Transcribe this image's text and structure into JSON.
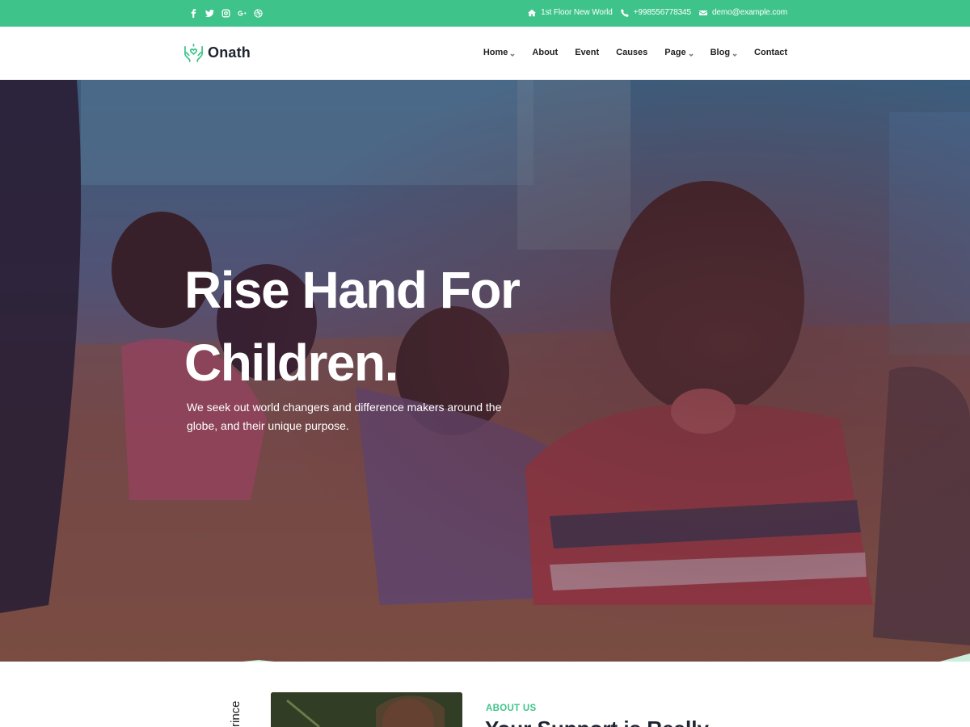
{
  "topbar": {
    "social": [
      "facebook-icon",
      "twitter-icon",
      "instagram-icon",
      "google-plus-icon",
      "dribbble-icon"
    ],
    "address": "1st Floor New World",
    "phone": "+998556778345",
    "email": "demo@example.com"
  },
  "brand": {
    "name": "Onath",
    "accent": "#3ec48a"
  },
  "nav": {
    "items": [
      {
        "label": "Home",
        "dropdown": true
      },
      {
        "label": "About",
        "dropdown": false
      },
      {
        "label": "Event",
        "dropdown": false
      },
      {
        "label": "Causes",
        "dropdown": false
      },
      {
        "label": "Page",
        "dropdown": true
      },
      {
        "label": "Blog",
        "dropdown": true
      },
      {
        "label": "Contact",
        "dropdown": false
      }
    ]
  },
  "hero": {
    "title_line1": "Rise Hand For",
    "title_line2": "Children.",
    "text": "We seek out world changers and difference makers around the globe, and their unique purpose."
  },
  "about": {
    "vertical_label": "rince",
    "kicker": "ABOUT US",
    "heading": "Your Support is Really"
  }
}
